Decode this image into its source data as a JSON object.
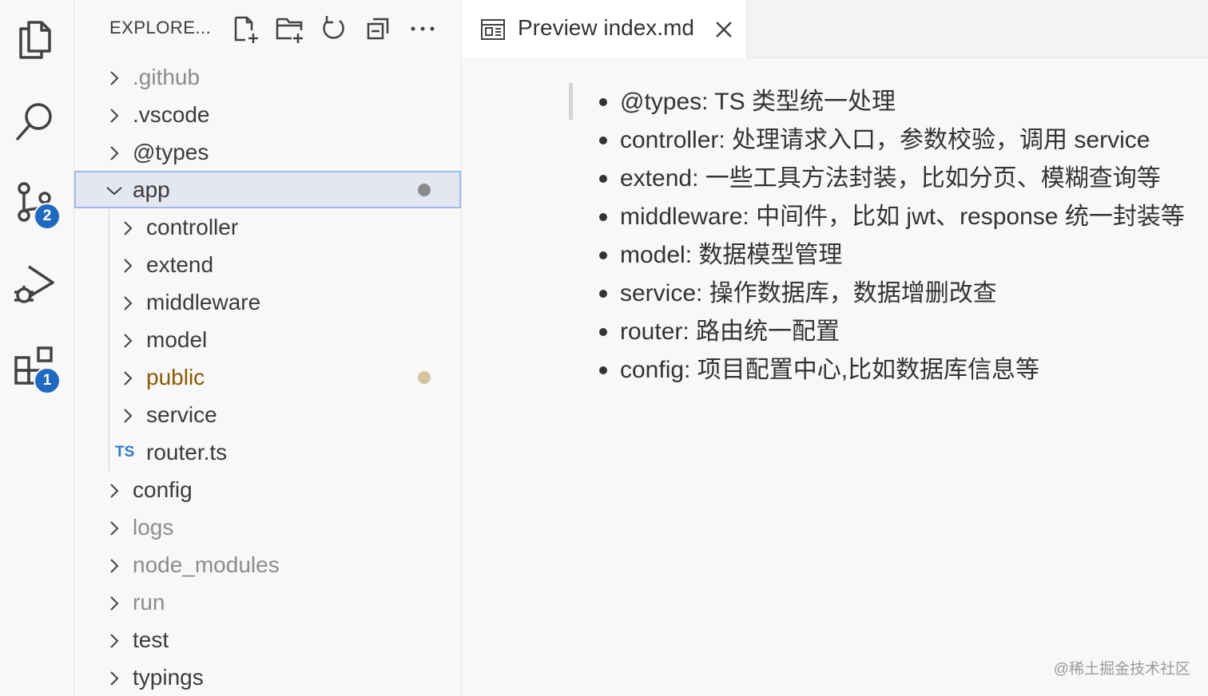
{
  "activity_bar": {
    "items": [
      {
        "icon": "files-icon"
      },
      {
        "icon": "search-icon"
      },
      {
        "icon": "source-control-icon",
        "badge": "2"
      },
      {
        "icon": "run-debug-icon"
      },
      {
        "icon": "extensions-icon",
        "badge": "1"
      }
    ],
    "badge_color": "#1f6ac0"
  },
  "explorer": {
    "title": "EXPLORE...",
    "actions": [
      "new-file-icon",
      "new-folder-icon",
      "refresh-icon",
      "collapse-all-icon",
      "more-actions-icon"
    ],
    "tree": [
      {
        "label": ".github",
        "type": "folder",
        "expanded": false,
        "muted": true
      },
      {
        "label": ".vscode",
        "type": "folder",
        "expanded": false
      },
      {
        "label": "@types",
        "type": "folder",
        "expanded": false
      },
      {
        "label": "app",
        "type": "folder",
        "expanded": true,
        "selected": true,
        "modified": true
      },
      {
        "label": "controller",
        "type": "folder",
        "expanded": false,
        "depth": 1
      },
      {
        "label": "extend",
        "type": "folder",
        "expanded": false,
        "depth": 1
      },
      {
        "label": "middleware",
        "type": "folder",
        "expanded": false,
        "depth": 1
      },
      {
        "label": "model",
        "type": "folder",
        "expanded": false,
        "depth": 1
      },
      {
        "label": "public",
        "type": "folder",
        "expanded": false,
        "depth": 1,
        "modified": true,
        "color": "#8a5a00"
      },
      {
        "label": "service",
        "type": "folder",
        "expanded": false,
        "depth": 1
      },
      {
        "label": "router.ts",
        "type": "file",
        "depth": 1,
        "file_icon": "TS"
      },
      {
        "label": "config",
        "type": "folder",
        "expanded": false
      },
      {
        "label": "logs",
        "type": "folder",
        "expanded": false,
        "muted": true
      },
      {
        "label": "node_modules",
        "type": "folder",
        "expanded": false,
        "muted": true
      },
      {
        "label": "run",
        "type": "folder",
        "expanded": false,
        "muted": true
      },
      {
        "label": "test",
        "type": "folder",
        "expanded": false
      },
      {
        "label": "typings",
        "type": "folder",
        "expanded": false
      }
    ]
  },
  "editor": {
    "tab": {
      "label": "Preview index.md",
      "icon": "preview-icon",
      "close_icon": "close-icon"
    },
    "preview_items": [
      "@types: TS 类型统一处理",
      "controller: 处理请求入口，参数校验，调用 service",
      "extend: 一些工具方法封装，比如分页、模糊查询等",
      "middleware: 中间件，比如 jwt、response 统一封装等",
      "model: 数据模型管理",
      "service: 操作数据库，数据增删改查",
      "router: 路由统一配置",
      "config: 项目配置中心,比如数据库信息等"
    ]
  },
  "watermark": "@稀土掘金技术社区"
}
